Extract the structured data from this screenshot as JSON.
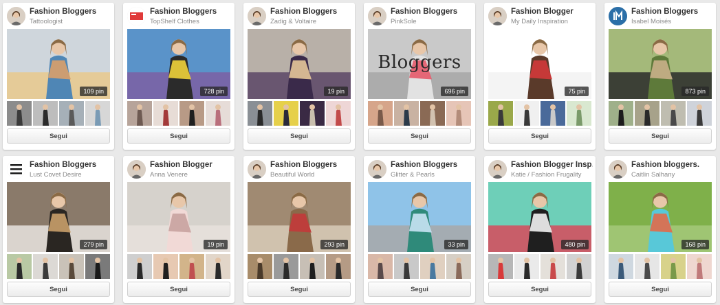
{
  "boards": [
    {
      "title": "Fashion Bloggers",
      "owner": "Tattoologist",
      "pins": "109 pin",
      "follow_label": "Segui",
      "avatar_icon": "profile-photo",
      "cover_colors": [
        "#cfd6dc",
        "#4f86b5",
        "#d9a06a",
        "#e9c98c"
      ],
      "thumb_colors": [
        [
          "#8c8c8c",
          "#3a3a3a"
        ],
        [
          "#bdbdbd",
          "#2b2b2b"
        ],
        [
          "#a6b0b8",
          "#5a5a5a"
        ],
        [
          "#d7d7d7",
          "#7a9bb5"
        ]
      ]
    },
    {
      "title": "Fashion Bloggers",
      "owner": "TopShelf Clothes",
      "pins": "728 pin",
      "follow_label": "Segui",
      "avatar_icon": "topshelf-logo",
      "cover_colors": [
        "#5a93c9",
        "#2b2b2b",
        "#f0d13a",
        "#7c5fa3"
      ],
      "thumb_colors": [
        [
          "#b7a49a",
          "#6e5a52"
        ],
        [
          "#e7dcd6",
          "#a33a3a"
        ],
        [
          "#b89a86",
          "#1f1f1f"
        ],
        [
          "#e6dcd8",
          "#b96f7c"
        ]
      ]
    },
    {
      "title": "Fashion Bloggers",
      "owner": "Zadig & Voltaire",
      "pins": "19 pin",
      "follow_label": "Segui",
      "avatar_icon": "profile-photo",
      "cover_colors": [
        "#b8b0a8",
        "#3a2a4a",
        "#e6c79a",
        "#5a4766"
      ],
      "thumb_colors": [
        [
          "#8a8f95",
          "#2a2a2a"
        ],
        [
          "#e6d04a",
          "#2a2a3a"
        ],
        [
          "#3a2a44",
          "#c9bfae"
        ],
        [
          "#eed6d6",
          "#c24a4a"
        ]
      ]
    },
    {
      "title": "Fashion Bloggers",
      "owner": "PinkSole",
      "pins": "696 pin",
      "follow_label": "Segui",
      "avatar_icon": "profile-photo",
      "cover_colors": [
        "#c9c9c9",
        "#e2e2e2",
        "#e55a6a",
        "#a7a7a7"
      ],
      "cover_text": "Bloggers",
      "thumb_colors": [
        [
          "#d6a58a",
          "#7a5a4a"
        ],
        [
          "#c9b2a2",
          "#2c3b4a"
        ],
        [
          "#8a6a55",
          "#d2c2b0"
        ],
        [
          "#e6c5b7",
          "#b38c7a"
        ]
      ]
    },
    {
      "title": "Fashion Blogger",
      "owner": "My Daily Inspiration",
      "pins": "75 pin",
      "follow_label": "Segui",
      "avatar_icon": "profile-photo",
      "cover_colors": [
        "#ffffff",
        "#5a3a2a",
        "#d23a3a",
        "#f2f2f2"
      ],
      "thumb_colors": [
        [
          "#9aa84a",
          "#3a3a3a"
        ],
        [
          "#f0f0f0",
          "#3a3a3a"
        ],
        [
          "#4a6a9a",
          "#c9c9c9"
        ],
        [
          "#d9e8d0",
          "#7a9a6a"
        ]
      ]
    },
    {
      "title": "Fashion Bloggers",
      "owner": "Isabel Moisés",
      "pins": "873 pin",
      "follow_label": "Segui",
      "avatar_icon": "im-logo",
      "cover_colors": [
        "#a4b97a",
        "#5e7a3a",
        "#c9b08a",
        "#2a2a2a"
      ],
      "thumb_colors": [
        [
          "#9fb08a",
          "#1c1c1c"
        ],
        [
          "#a7a28a",
          "#2a2a2a"
        ],
        [
          "#bfbdb0",
          "#4a4a4a"
        ],
        [
          "#cfd3da",
          "#3a3a3a"
        ]
      ]
    },
    {
      "title": "Fashion Bloggers",
      "owner": "Lust Covet Desire",
      "pins": "279 pin",
      "follow_label": "Segui",
      "avatar_icon": "lust-covet-desire-logo",
      "cover_colors": [
        "#8a7a6a",
        "#2a2622",
        "#c9a06a",
        "#e8e4df"
      ],
      "thumb_colors": [
        [
          "#b9c9a4",
          "#2a2a2a"
        ],
        [
          "#dcd9d5",
          "#3a3a3a"
        ],
        [
          "#c9c2b8",
          "#5a4a3a"
        ],
        [
          "#7a7a7a",
          "#1a1a1a"
        ]
      ]
    },
    {
      "title": "Fashion Blogger",
      "owner": "Anna Venere",
      "pins": "19 pin",
      "follow_label": "Segui",
      "avatar_icon": "profile-photo",
      "cover_colors": [
        "#d6d2cc",
        "#f1d9d6",
        "#c8a2a0",
        "#e8e2dc"
      ],
      "thumb_colors": [
        [
          "#cfcfcf",
          "#2a2a2a"
        ],
        [
          "#e7c9b2",
          "#1f1f1f"
        ],
        [
          "#d2b48a",
          "#c05050"
        ],
        [
          "#e2d6c9",
          "#2a2a2a"
        ]
      ]
    },
    {
      "title": "Fashion Bloggers",
      "owner": "Beautiful World",
      "pins": "293 pin",
      "follow_label": "Segui",
      "avatar_icon": "profile-photo",
      "cover_colors": [
        "#a08a72",
        "#8a6a4a",
        "#c23a3a",
        "#d8cbb8"
      ],
      "thumb_colors": [
        [
          "#a88c6a",
          "#4a3a2a"
        ],
        [
          "#9a9a9a",
          "#2a2a2a"
        ],
        [
          "#c7bfb5",
          "#1f1f1f"
        ],
        [
          "#b59b85",
          "#2a2a2a"
        ]
      ]
    },
    {
      "title": "Fashion Bloggers",
      "owner": "Glitter & Pearls",
      "pins": "33 pin",
      "follow_label": "Segui",
      "avatar_icon": "profile-photo",
      "cover_colors": [
        "#8fc3e8",
        "#2f8a7a",
        "#c9e3f4",
        "#a8a8a8"
      ],
      "thumb_colors": [
        [
          "#d9b8a8",
          "#5a4a4a"
        ],
        [
          "#c9c9c9",
          "#3a3a3a"
        ],
        [
          "#e0d0c0",
          "#4a7aa0"
        ],
        [
          "#d6cfc5",
          "#8a6a5a"
        ]
      ]
    },
    {
      "title": "Fashion Blogger Insp…",
      "owner": "Katie / Fashion Frugality",
      "pins": "480 pin",
      "follow_label": "Segui",
      "avatar_icon": "profile-photo",
      "cover_colors": [
        "#6ecfb8",
        "#1f1f1f",
        "#f2f2f2",
        "#d84a5a"
      ],
      "thumb_colors": [
        [
          "#b7b7b7",
          "#d83a3a"
        ],
        [
          "#eaeaea",
          "#2a2a2a"
        ],
        [
          "#e4e0da",
          "#c94a4a"
        ],
        [
          "#d2d2d2",
          "#3a3a3a"
        ]
      ]
    },
    {
      "title": "Fashion bloggers.",
      "owner": "Caitlin Salhany",
      "pins": "168 pin",
      "follow_label": "Segui",
      "avatar_icon": "profile-photo",
      "cover_colors": [
        "#7fb04a",
        "#58c8d8",
        "#e26a4a",
        "#a5c97a"
      ],
      "thumb_colors": [
        [
          "#cfd8e0",
          "#3a5a7a"
        ],
        [
          "#e6e6e6",
          "#4a4a4a"
        ],
        [
          "#d8d28a",
          "#7a9a4a"
        ],
        [
          "#efd7d0",
          "#c07a7a"
        ]
      ]
    }
  ]
}
